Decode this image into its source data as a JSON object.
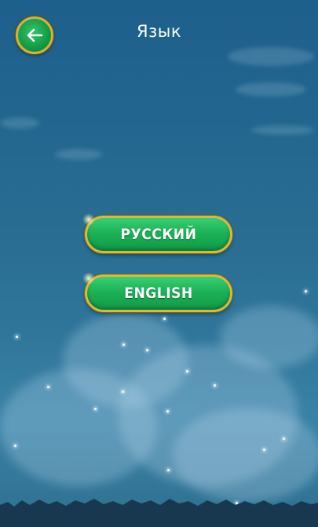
{
  "header": {
    "title": "Язык",
    "back_icon": "arrow-left-icon"
  },
  "languages": [
    {
      "label": "РУССКИЙ"
    },
    {
      "label": "ENGLISH"
    }
  ],
  "colors": {
    "button_green": "#1cb257",
    "button_border_gold": "#d8b843",
    "sky_top": "#1e5f8c",
    "sky_bottom": "#3a82a6",
    "title_text": "#ffffff"
  }
}
